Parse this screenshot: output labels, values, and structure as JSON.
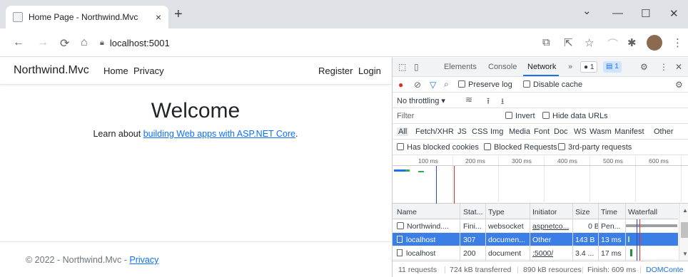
{
  "browser": {
    "tab_title": "Home Page - Northwind.Mvc",
    "tab_close": "×",
    "new_tab": "+",
    "minimize": "⌄",
    "restore": "—",
    "maximize": "☐",
    "close": "✕",
    "address": "localhost:5001"
  },
  "page": {
    "brand": "Northwind.Mvc",
    "nav": [
      "Home",
      "Privacy"
    ],
    "register": "Register",
    "login": "Login",
    "heading": "Welcome",
    "learn_prefix": "Learn about ",
    "learn_link": "building Web apps with ASP.NET Core",
    "learn_suffix": ".",
    "footer_text": "© 2022 - Northwind.Mvc - ",
    "footer_link": "Privacy"
  },
  "devtools": {
    "tabs": [
      "Elements",
      "Console",
      "Network"
    ],
    "more_tabs": "»",
    "error_count": "1",
    "message_count": "1",
    "preserve_log": "Preserve log",
    "disable_cache": "Disable cache",
    "throttling": "No throttling",
    "filter_placeholder": "Filter",
    "invert": "Invert",
    "hide_data_urls": "Hide data URLs",
    "type_filters": [
      "All",
      "Fetch/XHR",
      "JS",
      "CSS",
      "Img",
      "Media",
      "Font",
      "Doc",
      "WS",
      "Wasm",
      "Manifest",
      "Other"
    ],
    "has_blocked_cookies": "Has blocked cookies",
    "blocked_requests": "Blocked Requests",
    "third_party": "3rd-party requests",
    "timeline_ticks": [
      "100 ms",
      "200 ms",
      "300 ms",
      "400 ms",
      "500 ms",
      "600 ms"
    ],
    "columns": [
      "Name",
      "Stat...",
      "Type",
      "Initiator",
      "Size",
      "Time",
      "Waterfall"
    ],
    "rows": [
      {
        "name": "Northwind....",
        "status": "Fini...",
        "type": "websocket",
        "initiator": "aspnetco...",
        "size": "0 B",
        "time": "Pen..."
      },
      {
        "name": "localhost",
        "status": "307",
        "type": "documen...",
        "initiator": "Other",
        "size": "143 B",
        "time": "13 ms"
      },
      {
        "name": "localhost",
        "status": "200",
        "type": "document",
        "initiator": ":5000/",
        "size": "3.4 ...",
        "time": "17 ms"
      }
    ],
    "status_bar": {
      "requests": "11 requests",
      "transferred": "724 kB transferred",
      "resources": "890 kB resources",
      "finish": "Finish: 609 ms",
      "domcontent": "DOMConte"
    }
  }
}
